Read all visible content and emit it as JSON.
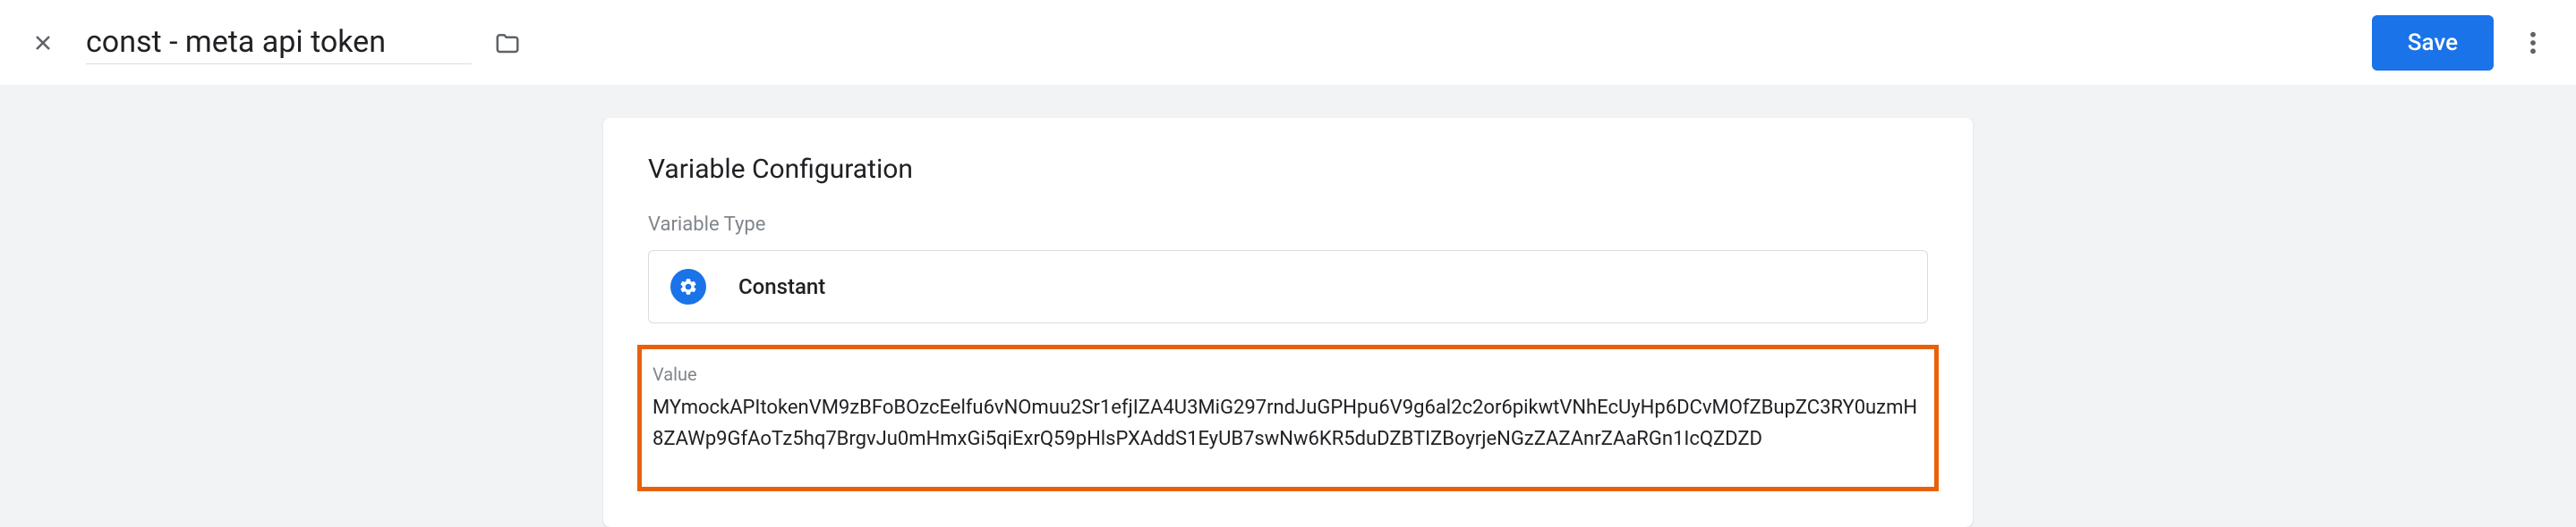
{
  "header": {
    "title": "const - meta api token",
    "save_label": "Save"
  },
  "card": {
    "title": "Variable Configuration",
    "type_label": "Variable Type",
    "type_name": "Constant",
    "value_label": "Value",
    "value_text": "MYmockAPItokenVM9zBFoBOzcEelfu6vNOmuu2Sr1efjIZA4U3MiG297rndJuGPHpu6V9g6al2c2or6pikwtVNhEcUyHp6DCvMOfZBupZC3RY0uzmH8ZAWp9GfAoTz5hq7BrgvJu0mHmxGi5qiExrQ59pHlsPXAddS1EyUB7swNw6KR5duDZBTIZBoyrjeNGzZAZAnrZAaRGn1IcQZDZD"
  }
}
